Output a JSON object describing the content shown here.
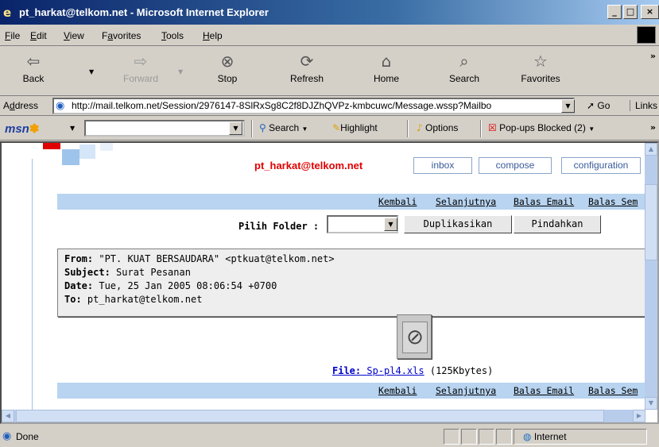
{
  "window": {
    "title": "pt_harkat@telkom.net - Microsoft Internet Explorer",
    "icon": "ie-logo-icon",
    "controls": [
      "minimize",
      "maximize",
      "close"
    ]
  },
  "menu": [
    {
      "pre": "",
      "key": "F",
      "post": "ile"
    },
    {
      "pre": "",
      "key": "E",
      "post": "dit"
    },
    {
      "pre": "",
      "key": "V",
      "post": "iew"
    },
    {
      "pre": "F",
      "key": "a",
      "post": "vorites"
    },
    {
      "pre": "",
      "key": "T",
      "post": "ools"
    },
    {
      "pre": "",
      "key": "H",
      "post": "elp"
    }
  ],
  "toolbar": {
    "back": "Back",
    "forward": "Forward",
    "stop": "Stop",
    "refresh": "Refresh",
    "home": "Home",
    "search": "Search",
    "favorites": "Favorites",
    "more": "»"
  },
  "address": {
    "label_pre": "A",
    "label_key": "d",
    "label_post": "dress",
    "url": "http://mail.telkom.net/Session/2976147-8SlRxSg8C2f8DJZhQVPz-kmbcuwc/Message.wssp?Mailbo",
    "go": "Go",
    "links": "Links"
  },
  "msn": {
    "logo": "msn",
    "search": "Search",
    "highlight": "Highlight",
    "options": "Options",
    "popups": "Pop-ups Blocked (2)",
    "more": "»"
  },
  "page": {
    "account": "pt_harkat@telkom.net",
    "nav": {
      "inbox": "inbox",
      "compose": "compose",
      "configuration": "configuration"
    },
    "actions": {
      "back": "Kembali",
      "next": "Selanjutnya",
      "reply": "Balas Email",
      "reply_all": "Balas Sem"
    },
    "folder_label": "Pilih Folder :",
    "copy_button": "Duplikasikan",
    "move_button": "Pindahkan",
    "header": {
      "from_label": "From:",
      "from_value": "\"PT. KUAT BERSAUDARA\" <ptkuat@telkom.net>",
      "subject_label": "Subject:",
      "subject_value": "Surat Pesanan",
      "date_label": "Date:",
      "date_value": "Tue, 25 Jan 2005 08:06:54 +0700",
      "to_label": "To:",
      "to_value": "pt_harkat@telkom.net"
    },
    "attachment": {
      "icon": "paperclip-icon",
      "label": "File:",
      "filename": "Sp-pl4.xls",
      "size": "(125Kbytes)"
    }
  },
  "status": {
    "text": "Done",
    "zone": "Internet"
  }
}
